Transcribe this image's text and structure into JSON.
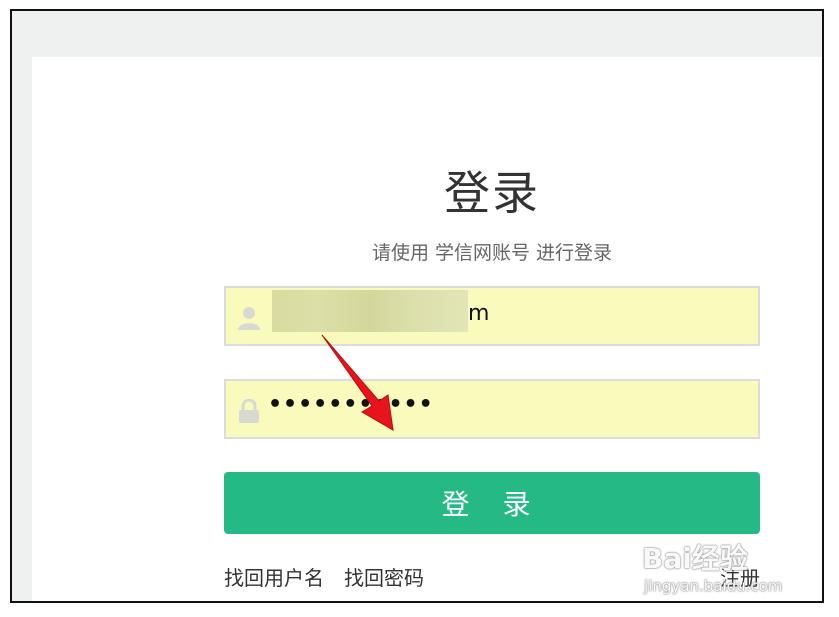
{
  "page": {
    "title": "登录",
    "subtitle": "请使用 学信网账号 进行登录"
  },
  "form": {
    "username": {
      "icon": "user-icon",
      "value_visible": "m"
    },
    "password": {
      "icon": "lock-icon",
      "value": "•••••••••••"
    },
    "submit_label": "登 录"
  },
  "links": {
    "find_username": "找回用户名",
    "find_password": "找回密码",
    "register": "注册"
  },
  "watermark": {
    "brand": "Bai经验",
    "url": "jingyan.baidu.com"
  },
  "colors": {
    "accent": "#25b986",
    "input_autofill": "#f8fbbc",
    "annotation_arrow": "#e8141c"
  }
}
